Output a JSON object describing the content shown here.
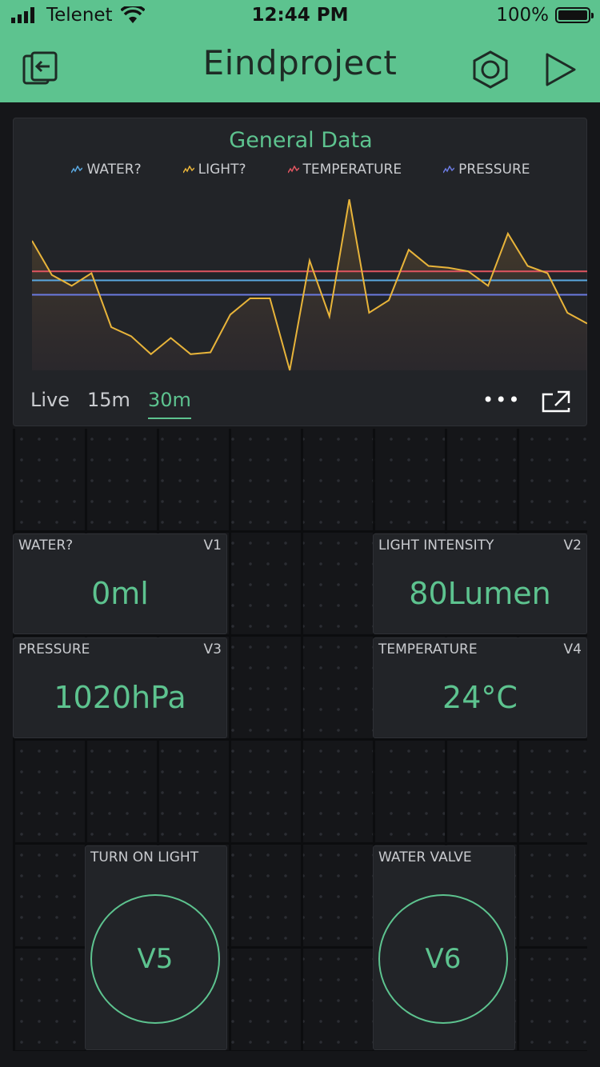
{
  "status": {
    "carrier": "Telenet",
    "time": "12:44 PM",
    "battery": "100%"
  },
  "header": {
    "title": "Eindproject"
  },
  "chart": {
    "title": "General Data",
    "legend": [
      {
        "name": "WATER?",
        "color": "#5aa8e0"
      },
      {
        "name": "LIGHT?",
        "color": "#e8b43a"
      },
      {
        "name": "TEMPERATURE",
        "color": "#e05560"
      },
      {
        "name": "PRESSURE",
        "color": "#6b7ae0"
      }
    ],
    "ranges": [
      "Live",
      "15m",
      "30m"
    ],
    "active_range": "30m",
    "more_label": "•••"
  },
  "chart_data": {
    "type": "line",
    "title": "General Data",
    "ylim": [
      0,
      100
    ],
    "series": [
      {
        "name": "WATER?",
        "color": "#5aa8e0",
        "values": [
          50,
          50,
          50,
          50,
          50,
          50,
          50,
          50,
          50,
          50,
          50,
          50,
          50,
          50,
          50,
          50,
          50,
          50,
          50,
          50,
          50,
          50,
          50,
          50,
          50,
          50,
          50,
          50,
          50,
          50
        ]
      },
      {
        "name": "LIGHT?",
        "color": "#e8b43a",
        "values": [
          72,
          53,
          47,
          54,
          24,
          19,
          9,
          18,
          9,
          10,
          31,
          40,
          40,
          0,
          61,
          30,
          95,
          32,
          39,
          67,
          58,
          57,
          55,
          47,
          76,
          58,
          54,
          32,
          26
        ]
      },
      {
        "name": "TEMPERATURE",
        "color": "#e05560",
        "values": [
          55,
          55,
          55,
          55,
          55,
          55,
          55,
          55,
          55,
          55,
          55,
          55,
          55,
          55,
          55,
          55,
          55,
          55,
          55,
          55,
          55,
          55,
          55,
          55,
          55,
          55,
          55,
          55,
          55,
          55
        ]
      },
      {
        "name": "PRESSURE",
        "color": "#6b7ae0",
        "values": [
          42,
          42,
          42,
          42,
          42,
          42,
          42,
          42,
          42,
          42,
          42,
          42,
          42,
          42,
          42,
          42,
          42,
          42,
          42,
          42,
          42,
          42,
          42,
          42,
          42,
          42,
          42,
          42,
          42,
          42
        ]
      }
    ]
  },
  "widgets": {
    "water": {
      "label": "WATER?",
      "pin": "V1",
      "value": "0ml"
    },
    "light": {
      "label": "LIGHT INTENSITY",
      "pin": "V2",
      "value": "80Lumen"
    },
    "pressure": {
      "label": "PRESSURE",
      "pin": "V3",
      "value": "1020hPa"
    },
    "temperature": {
      "label": "TEMPERATURE",
      "pin": "V4",
      "value": "24°C"
    },
    "light_button": {
      "label": "TURN ON LIGHT",
      "pin": "V5"
    },
    "valve_button": {
      "label": "WATER VALVE",
      "pin": "V6"
    }
  },
  "colors": {
    "accent": "#5dc38f",
    "background": "#151619",
    "panel": "#222428"
  }
}
